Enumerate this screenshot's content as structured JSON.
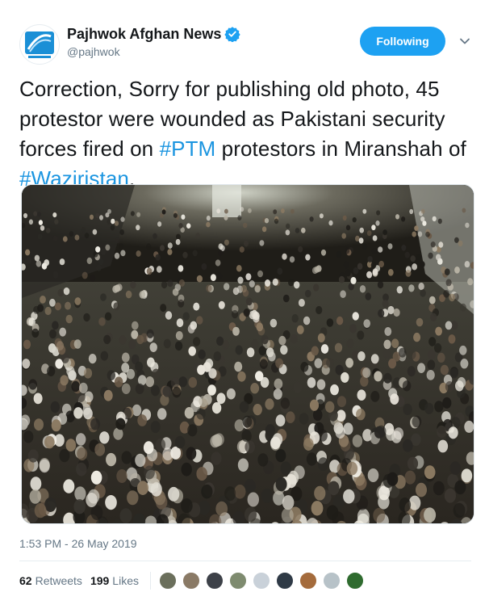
{
  "account": {
    "display_name": "Pajhwok Afghan News",
    "handle": "@pajhwok",
    "avatar_icon": "pajhwok-logo",
    "verified_icon": "verified-badge-icon"
  },
  "follow_button": {
    "label": "Following"
  },
  "tweet": {
    "text_parts": [
      "Correction, Sorry for publishing old photo, 45 protestor were wounded as Pakistani security forces fired on ",
      "#PTM",
      " protestors in Miranshah of ",
      "#Waziristan",
      "."
    ],
    "timestamp": "1:53 PM - 26 May 2019"
  },
  "stats": {
    "retweets_count": "62",
    "retweets_label": "Retweets",
    "likes_count": "199",
    "likes_label": "Likes"
  },
  "likers": [
    {
      "name": "liker-avatar-1",
      "color": "#6b6f5c"
    },
    {
      "name": "liker-avatar-2",
      "color": "#8a7a66"
    },
    {
      "name": "liker-avatar-3",
      "color": "#3d4148"
    },
    {
      "name": "liker-avatar-4",
      "color": "#7e8b6f"
    },
    {
      "name": "liker-avatar-5",
      "color": "#c9d1d9"
    },
    {
      "name": "liker-avatar-6",
      "color": "#2f3a46"
    },
    {
      "name": "liker-avatar-7",
      "color": "#a46b3c"
    },
    {
      "name": "liker-avatar-8",
      "color": "#b7c2c8"
    },
    {
      "name": "liker-avatar-9",
      "color": "#2f6b2f"
    }
  ],
  "colors": {
    "accent": "#1da1f2",
    "hashtag": "#1b95e0",
    "muted": "#657786"
  }
}
